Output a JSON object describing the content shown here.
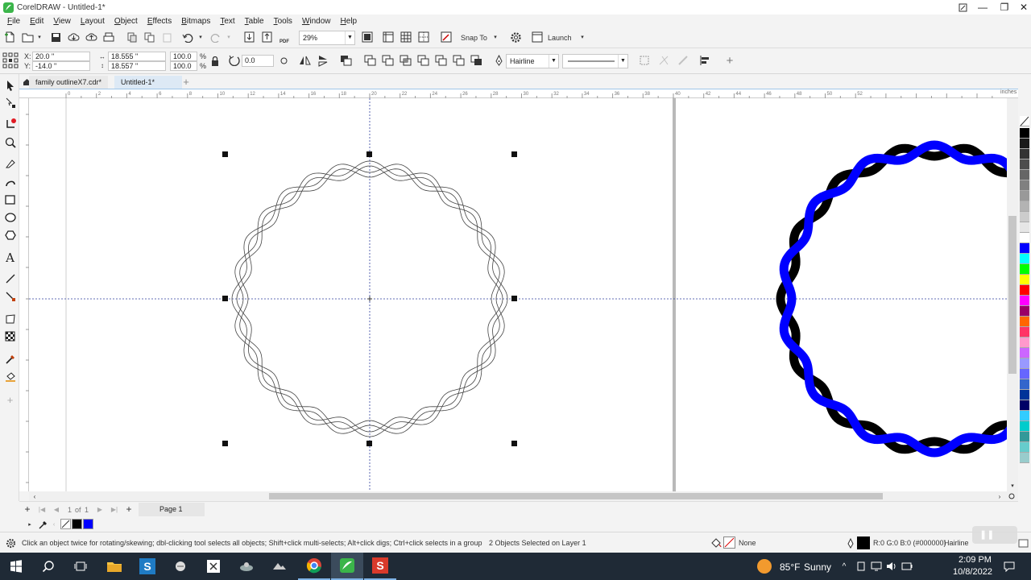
{
  "window": {
    "title": "CorelDRAW - Untitled-1*",
    "minimize": "—",
    "maximize": "❐",
    "close": "✕"
  },
  "menu": [
    "File",
    "Edit",
    "View",
    "Layout",
    "Object",
    "Effects",
    "Bitmaps",
    "Text",
    "Table",
    "Tools",
    "Window",
    "Help"
  ],
  "toolbar": {
    "zoom": "29%",
    "snap_to": "Snap To",
    "launch": "Launch",
    "pdf": "PDF"
  },
  "property_bar": {
    "x_label": "X:",
    "x": "20.0 \"",
    "y_label": "Y:",
    "y": "-14.0 \"",
    "width": "18.555 \"",
    "height": "18.557 \"",
    "scale_w": "100.0",
    "scale_h": "100.0",
    "pct": "%",
    "rotation": "0.0",
    "outline": "Hairline"
  },
  "doc_tabs": [
    {
      "label": "family outlineX7.cdr*",
      "active": false
    },
    {
      "label": "Untitled-1*",
      "active": true
    }
  ],
  "ruler": {
    "units": "inches",
    "labels": [
      "0",
      "2",
      "4",
      "6",
      "8",
      "10",
      "12",
      "14",
      "16",
      "18",
      "20",
      "22",
      "24",
      "26",
      "28",
      "30",
      "32",
      "34",
      "36",
      "38",
      "40",
      "42",
      "44",
      "46",
      "48",
      "50",
      "52"
    ]
  },
  "page_nav": {
    "current": "1",
    "of": "of",
    "total": "1",
    "page_tab": "Page 1"
  },
  "palette_colors": [
    "#ffffff",
    "#000000",
    "#1a1a1a",
    "#333333",
    "#4d4d4d",
    "#666666",
    "#808080",
    "#999999",
    "#b3b3b3",
    "#cccccc",
    "#e6e6e6",
    "#ffffff",
    "#0000ff",
    "#00ffff",
    "#00ff00",
    "#ffff00",
    "#ff0000",
    "#ff00ff",
    "#990066",
    "#ff6600",
    "#ff3366",
    "#ff99cc",
    "#cc66ff",
    "#9999ff",
    "#6666ff",
    "#3366cc",
    "#003399",
    "#000066",
    "#33ccff",
    "#00cccc",
    "#339999",
    "#66cccc",
    "#99cccc"
  ],
  "doc_palette_colors": [
    "#000000",
    "#0000ff"
  ],
  "status": {
    "hint": "Click an object twice for rotating/skewing; dbl-clicking tool selects all objects; Shift+click multi-selects; Alt+click digs; Ctrl+click selects in a group",
    "selection": "2 Objects Selected on Layer 1",
    "fill_label": "None",
    "outline_color": "R:0 G:0 B:0 (#000000)",
    "outline_width": "Hairline"
  },
  "taskbar": {
    "weather_temp": "85°F",
    "weather_text": "Sunny",
    "time": "2:09 PM",
    "date": "10/8/2022"
  },
  "accent": "#1e73be"
}
